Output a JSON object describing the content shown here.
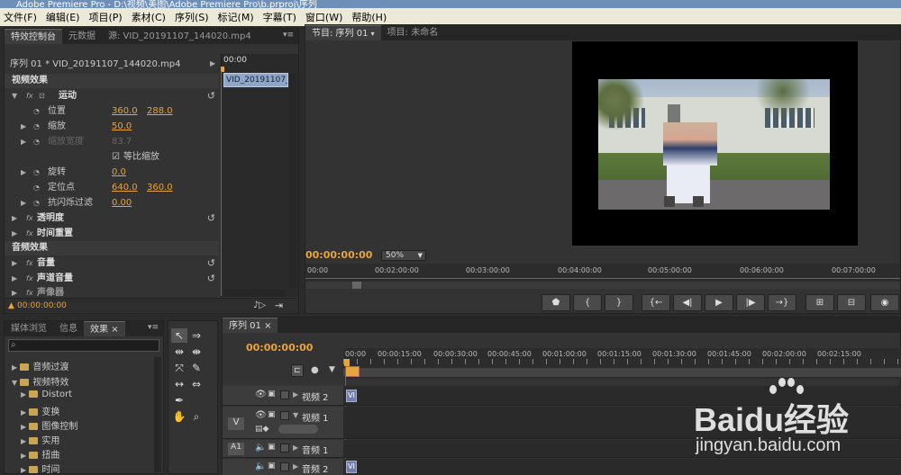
{
  "window": {
    "title": "Adobe Premiere Pro - D:\\视频\\美图\\Adobe Premiere Pro\\b.prproj\\序列"
  },
  "menu": [
    "文件(F)",
    "编辑(E)",
    "项目(P)",
    "素材(C)",
    "序列(S)",
    "标记(M)",
    "字幕(T)",
    "窗口(W)",
    "帮助(H)"
  ],
  "effect_controls": {
    "tabs": [
      "特效控制台",
      "元数据",
      "源: VID_20191107_144020.mp4"
    ],
    "clip_header": "序列 01 * VID_20191107_144020.mp4",
    "ruler_time": "00:00",
    "clip_bar": "VID_20191107_1",
    "video_section": "视频效果",
    "motion": "运动",
    "position": {
      "label": "位置",
      "x": "360.0",
      "y": "288.0"
    },
    "scale": {
      "label": "缩放",
      "value": "50.0"
    },
    "scale_width": {
      "label": "缩放宽度",
      "value": "83.7"
    },
    "uniform_scale": "等比缩放",
    "rotation": {
      "label": "旋转",
      "value": "0.0"
    },
    "anchor": {
      "label": "定位点",
      "x": "640.0",
      "y": "360.0"
    },
    "antiflicker": {
      "label": "抗闪烁过滤",
      "value": "0.00"
    },
    "opacity": "透明度",
    "time_remap": "时间重置",
    "audio_section": "音频效果",
    "volume": "音量",
    "channel_volume": "声道音量",
    "panner": "声像器",
    "timecode": "00:00:00:00"
  },
  "program": {
    "tabs": [
      "节目: 序列 01",
      "项目: 未命名"
    ],
    "timecode": "00:00:00:00",
    "zoom": "50%",
    "ruler": [
      "00:00",
      "00:02:00:00",
      "00:03:00:00",
      "00:04:00:00",
      "00:05:00:00",
      "00:06:00:00",
      "00:07:00:00"
    ]
  },
  "effects_panel": {
    "tabs": [
      "媒体浏览",
      "信息",
      "效果"
    ],
    "tree": [
      {
        "label": "音频过渡",
        "level": 0,
        "open": false
      },
      {
        "label": "视频特效",
        "level": 0,
        "open": true
      },
      {
        "label": "Distort",
        "level": 1,
        "open": false
      },
      {
        "label": "变换",
        "level": 1,
        "open": false
      },
      {
        "label": "图像控制",
        "level": 1,
        "open": false
      },
      {
        "label": "实用",
        "level": 1,
        "open": false
      },
      {
        "label": "扭曲",
        "level": 1,
        "open": false
      },
      {
        "label": "时间",
        "level": 1,
        "open": false
      }
    ]
  },
  "timeline": {
    "tab": "序列 01",
    "timecode": "00:00:00:00",
    "ruler": [
      "00:00",
      "00:00:15:00",
      "00:00:30:00",
      "00:00:45:00",
      "00:01:00:00",
      "00:01:15:00",
      "00:01:30:00",
      "00:01:45:00",
      "00:02:00:00",
      "00:02:15:00"
    ],
    "tracks": {
      "video2": "视频 2",
      "video1": "视频 1",
      "audio1": "音频 1",
      "audio2": "音频 2",
      "v_label": "V",
      "a1_label": "A1",
      "clip_badge": "VI"
    }
  },
  "watermark": {
    "main": "Baidu经验",
    "sub": "jingyan.baidu.com"
  }
}
